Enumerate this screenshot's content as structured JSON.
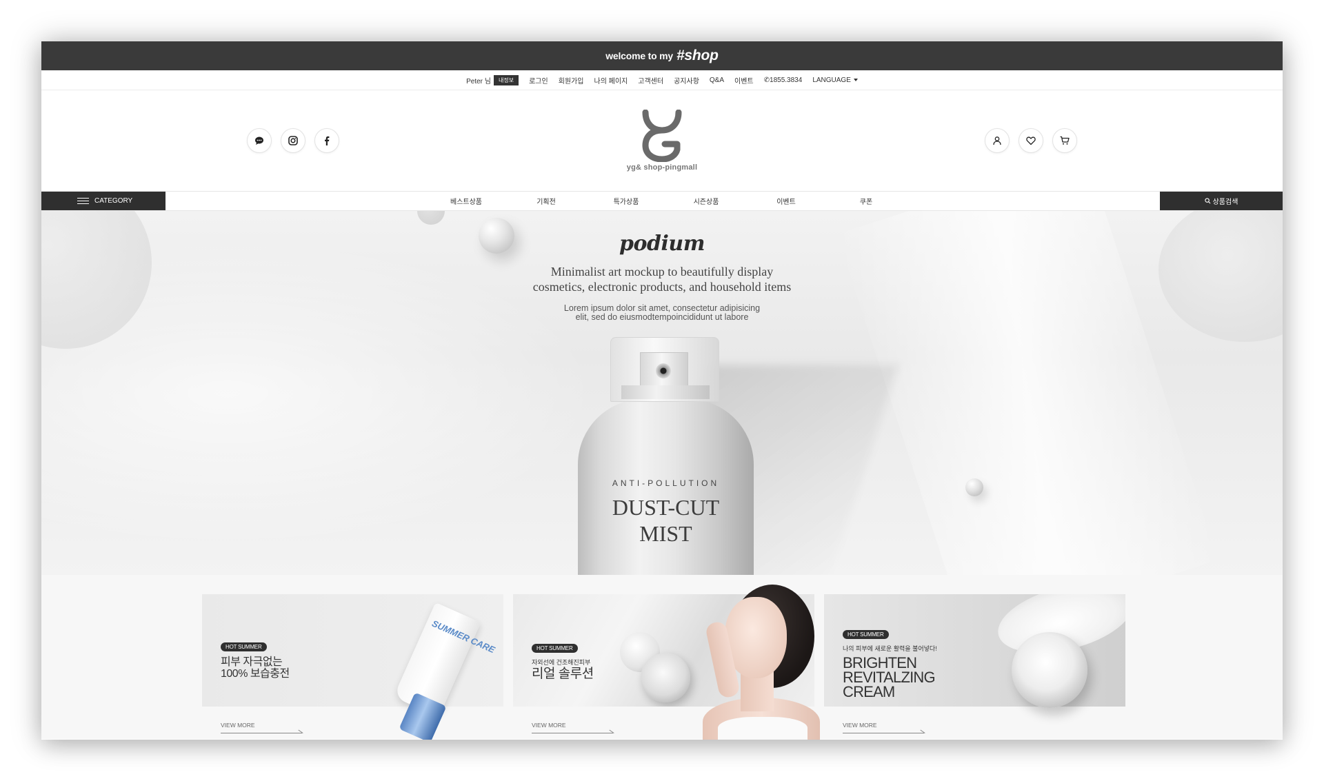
{
  "topbar": {
    "welcome_text": "welcome to my",
    "welcome_brand": "#shop"
  },
  "utility": {
    "user_name": "Peter 님",
    "my_info_badge": "내정보",
    "links": [
      "로그인",
      "회원가입",
      "나의 페이지",
      "고객센터",
      "공지사항",
      "Q&A",
      "이벤트"
    ],
    "phone": "1855.3834",
    "language": "LANGUAGE"
  },
  "header": {
    "logo_text": "yg& shop-pingmall",
    "social_icons": [
      "chat-icon",
      "instagram-icon",
      "facebook-icon"
    ],
    "user_icons": [
      "user-icon",
      "heart-icon",
      "cart-icon"
    ]
  },
  "nav": {
    "category_label": "CATEGORY",
    "menu": [
      "베스트상품",
      "기획전",
      "특가상품",
      "시즌상품",
      "이벤트",
      "쿠폰"
    ],
    "search_label": "상품검색"
  },
  "hero": {
    "title": "podium",
    "subtitle_line1": "Minimalist art mockup to beautifully display",
    "subtitle_line2": "cosmetics, electronic products, and household items",
    "body_line1": "Lorem ipsum dolor sit amet, consectetur adipisicing",
    "body_line2": "elit, sed do eiusmodtempoincididunt ut labore",
    "product_small": "ANTI-POLLUTION",
    "product_line1": "DUST-CUT",
    "product_line2": "MIST"
  },
  "banners": [
    {
      "tag": "HOT SUMMER",
      "line1": "피부 자극없는",
      "line2": "100% 보습충전",
      "product_label": "SUMMER CARE",
      "view_more": "VIEW MORE"
    },
    {
      "tag": "HOT SUMMER",
      "small": "자외선에 건조해진피부",
      "large": "리얼 솔루션",
      "view_more": "VIEW MORE"
    },
    {
      "tag": "HOT SUMMER",
      "small": "나의 피부에 새로운 활력을 불어넣다!",
      "line1": "BRIGHTEN",
      "line2": "REVITALZING",
      "line3": "CREAM",
      "view_more": "VIEW MORE"
    }
  ]
}
